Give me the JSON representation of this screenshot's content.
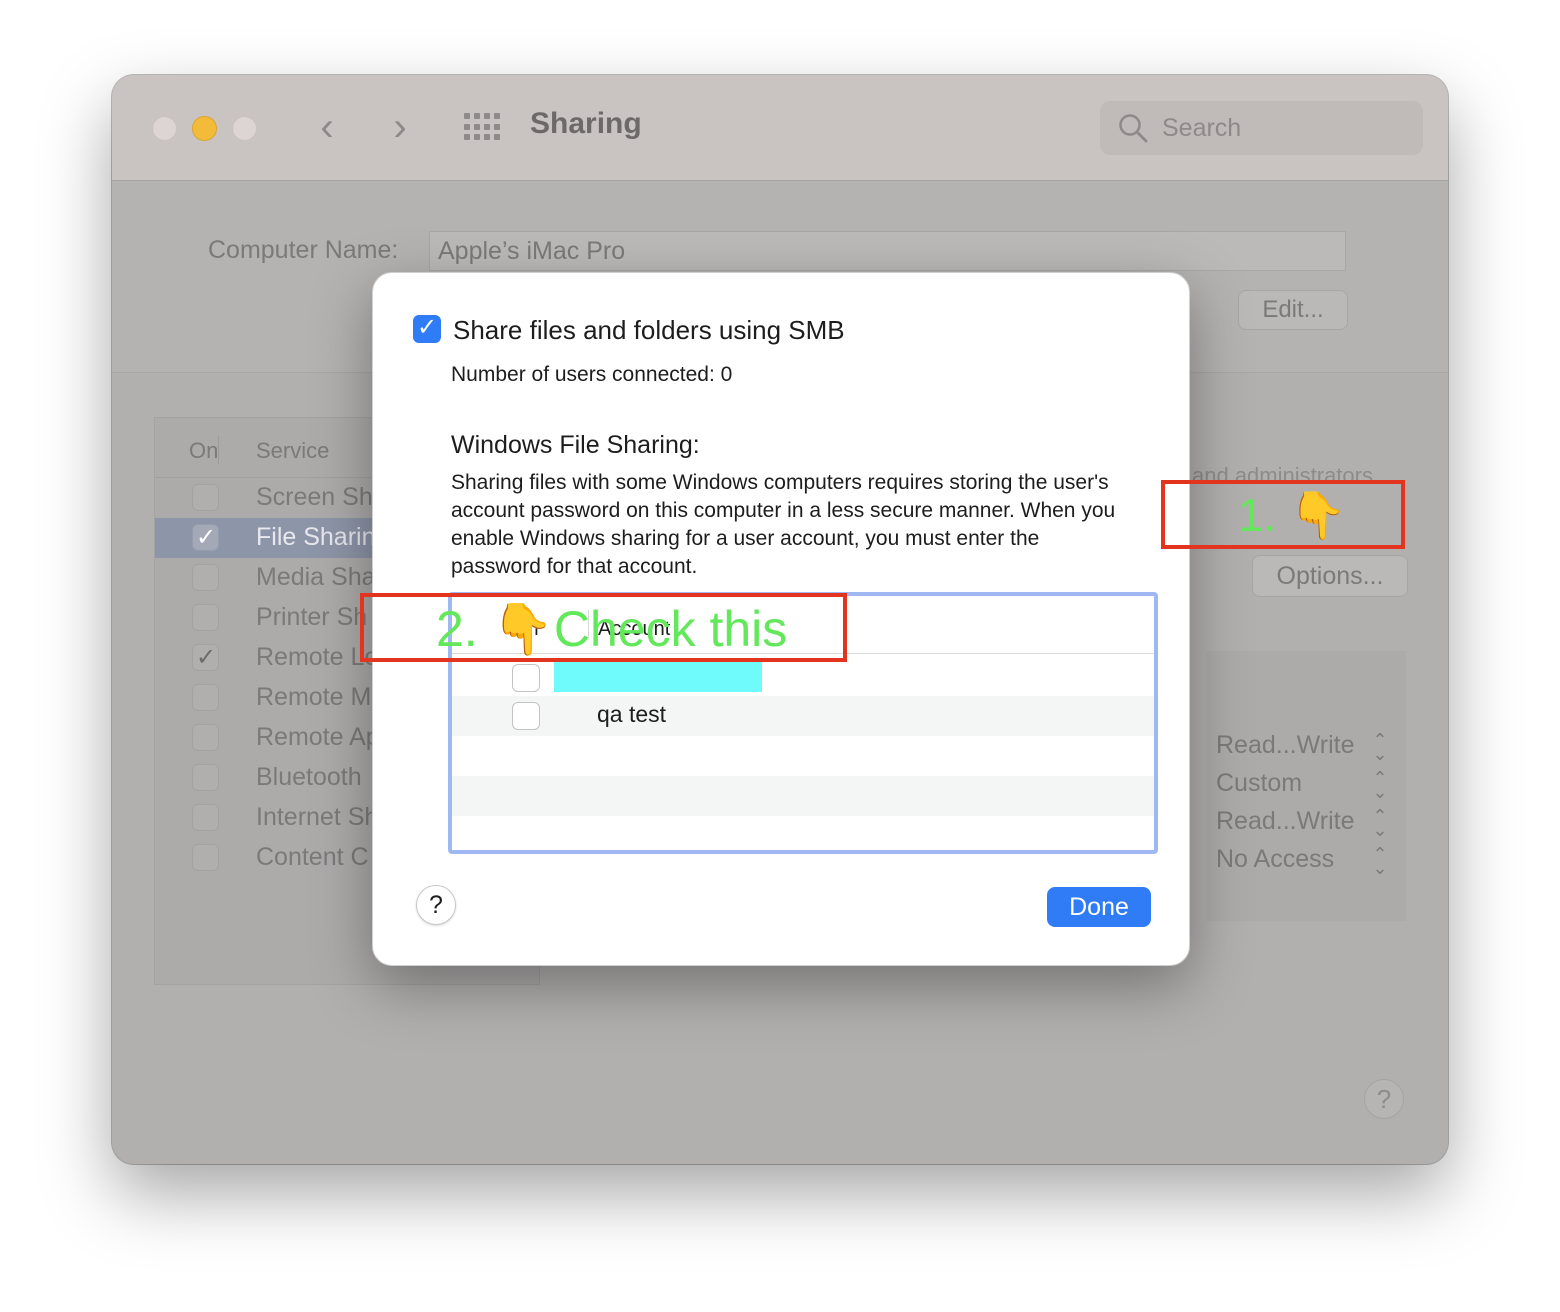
{
  "window": {
    "title": "Sharing",
    "search_placeholder": "Search"
  },
  "computer_name": {
    "label": "Computer Name:",
    "value": "Apple’s iMac Pro",
    "edit_label": "Edit..."
  },
  "services": {
    "header_on": "On",
    "header_service": "Service",
    "items": [
      {
        "label": "Screen Sh",
        "checked": false,
        "selected": false
      },
      {
        "label": "File Sharin",
        "checked": true,
        "selected": true
      },
      {
        "label": "Media Sha",
        "checked": false,
        "selected": false
      },
      {
        "label": "Printer Sh",
        "checked": false,
        "selected": false
      },
      {
        "label": "Remote Lo",
        "checked": true,
        "selected": false
      },
      {
        "label": "Remote M",
        "checked": false,
        "selected": false
      },
      {
        "label": "Remote Ap",
        "checked": false,
        "selected": false
      },
      {
        "label": "Bluetooth",
        "checked": false,
        "selected": false
      },
      {
        "label": "Internet Sh",
        "checked": false,
        "selected": false
      },
      {
        "label": "Content C",
        "checked": false,
        "selected": false
      }
    ]
  },
  "background_right": {
    "admin_text": "and administrators",
    "options_label": "Options...",
    "permissions": [
      "Read...Write",
      "Custom",
      "Read...Write",
      "No Access"
    ]
  },
  "sheet": {
    "smb_label": "Share files and folders using SMB",
    "smb_checked": true,
    "users_connected": "Number of users connected: 0",
    "wfs_title": "Windows File Sharing:",
    "wfs_description": "Sharing files with some Windows computers requires storing the user's account password on this computer in a less secure manner. When you enable Windows sharing for a user account, you must enter the password for that account.",
    "table_header_on": "On",
    "table_header_account": "Account",
    "accounts": [
      {
        "name": "",
        "checked": false,
        "redacted": true
      },
      {
        "name": "qa test",
        "checked": false,
        "redacted": false
      }
    ],
    "help_label": "?",
    "done_label": "Done"
  },
  "window_help_label": "?",
  "annotations": {
    "step1": "1. 👇",
    "step2": "2. 👇Check this"
  },
  "colors": {
    "accent_blue": "#2f7cf6",
    "annotation_red": "#e2341f",
    "annotation_green": "#62e85a",
    "redaction_cyan": "#6ffbfb"
  }
}
